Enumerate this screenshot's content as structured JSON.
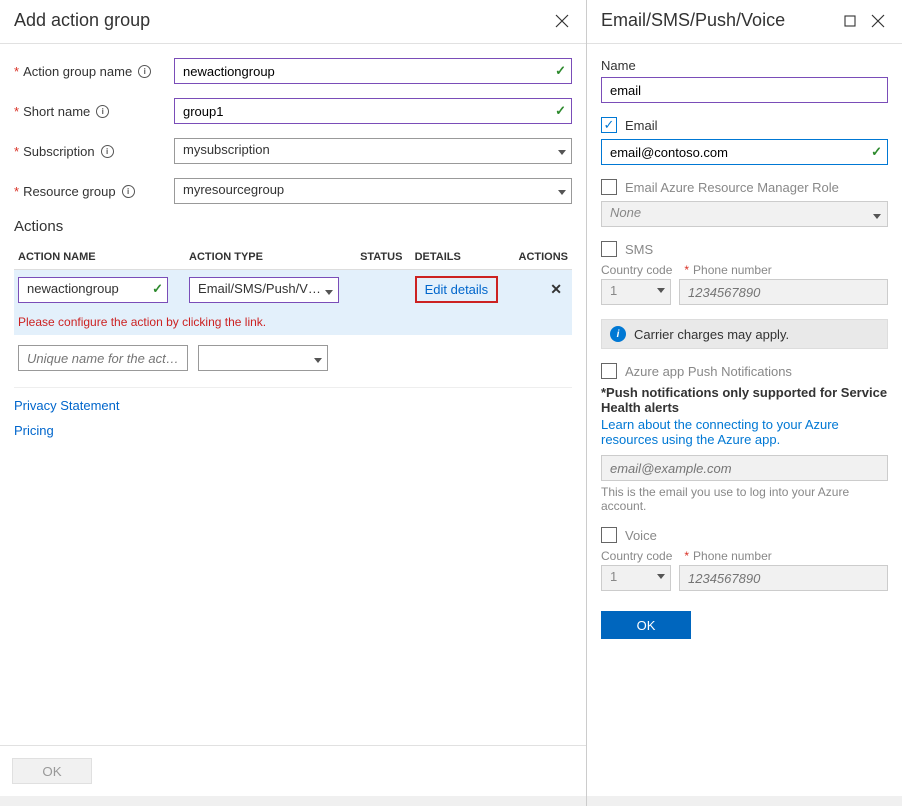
{
  "left": {
    "title": "Add action group",
    "fields": {
      "action_group_name": {
        "label": "Action group name",
        "value": "newactiongroup"
      },
      "short_name": {
        "label": "Short name",
        "value": "group1"
      },
      "subscription": {
        "label": "Subscription",
        "value": "mysubscription"
      },
      "resource_group": {
        "label": "Resource group",
        "value": "myresourcegroup"
      }
    },
    "actions_heading": "Actions",
    "columns": {
      "name": "ACTION NAME",
      "type": "ACTION TYPE",
      "status": "STATUS",
      "details": "DETAILS",
      "actions": "ACTIONS"
    },
    "row1": {
      "name": "newactiongroup",
      "type": "Email/SMS/Push/V…",
      "edit": "Edit details",
      "error": "Please configure the action by clicking the link."
    },
    "row2_placeholder": "Unique name for the act…",
    "links": {
      "privacy": "Privacy Statement",
      "pricing": "Pricing"
    },
    "ok": "OK"
  },
  "right": {
    "title": "Email/SMS/Push/Voice",
    "name_label": "Name",
    "name_value": "email",
    "email_check": "Email",
    "email_value": "email@contoso.com",
    "arm_check": "Email Azure Resource Manager Role",
    "arm_none": "None",
    "sms_check": "SMS",
    "cc_label": "Country code",
    "phone_label": "Phone number",
    "cc_value": "1",
    "phone_placeholder": "1234567890",
    "carrier": "Carrier charges may apply.",
    "push_check": "Azure app Push Notifications",
    "push_note": "*Push notifications only supported for Service Health alerts",
    "push_learn": "Learn about the connecting to your Azure resources using the Azure app.",
    "push_email_placeholder": "email@example.com",
    "push_help": "This is the email you use to log into your Azure account.",
    "voice_check": "Voice",
    "ok": "OK"
  }
}
